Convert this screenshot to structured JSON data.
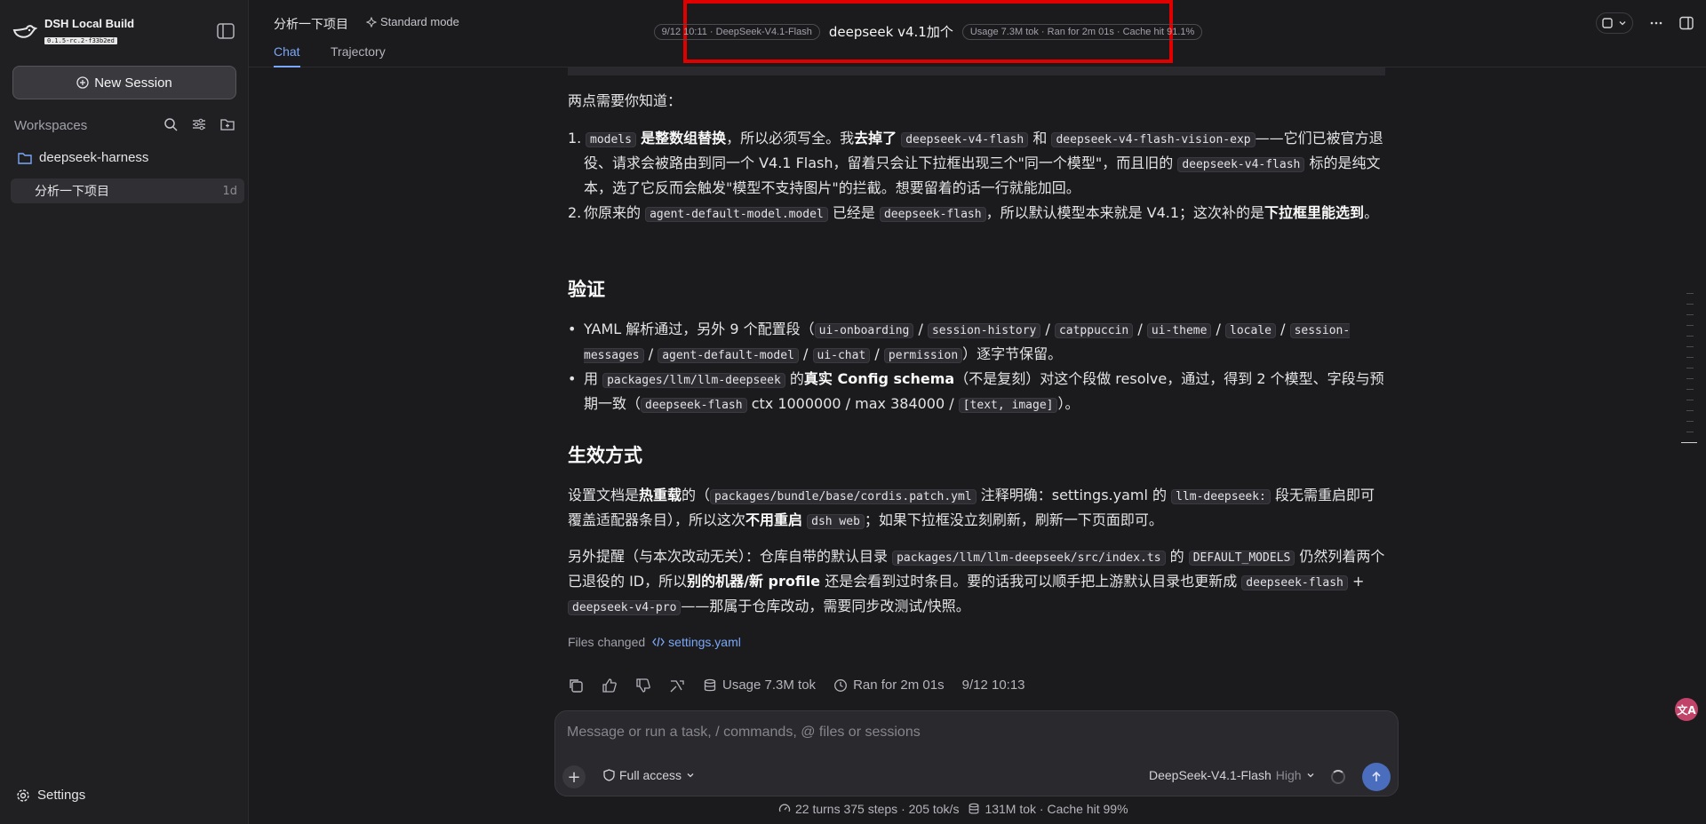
{
  "app": {
    "title": "DSH Local Build",
    "version": "0.1.5-rc.2-f33b2ed"
  },
  "sidebar": {
    "new_session": "New Session",
    "workspaces_label": "Workspaces",
    "project": "deepseek-harness",
    "session": {
      "label": "分析一下项目",
      "age": "1d"
    },
    "settings": "Settings"
  },
  "header": {
    "title": "分析一下项目",
    "mode": "Standard mode",
    "tabs": [
      "Chat",
      "Trajectory"
    ],
    "session_pill": "9/12 10:11 · DeepSeek-V4.1-Flash",
    "session_name": "deepseek v4.1加个",
    "usage_pill": "Usage 7.3M tok · Ran for 2m 01s · Cache hit 91.1%"
  },
  "content": {
    "intro": "两点需要你知道：",
    "ol": [
      {
        "marker": "1.",
        "code1": "models",
        "bold1": "是整数组替换",
        "t1": "，所以必须写全。我",
        "bold2": "去掉了",
        "code2": "deepseek-v4-flash",
        "t2": "和",
        "code3": "deepseek-v4-flash-vision-exp",
        "t3": "——它们已被官方退役、请求会被路由到同一个 V4.1 Flash，留着只会让下拉框出现三个\"同一个模型\"，而且旧的",
        "code4": "deepseek-v4-flash",
        "t4": "标的是纯文本，选了它反而会触发\"模型不支持图片\"的拦截。想要留着的话一行就能加回。"
      },
      {
        "marker": "2.",
        "t1": "你原来的",
        "code1": "agent-default-model.model",
        "t2": "已经是",
        "code2": "deepseek-flash",
        "t3": "，所以默认模型本来就是 V4.1；这次补的是",
        "bold1": "下拉框里能选到",
        "t4": "。"
      }
    ],
    "h_verify": "验证",
    "verify": [
      {
        "t1": "YAML 解析通过，另外 9 个配置段（",
        "codes": [
          "ui-onboarding",
          "session-history",
          "catppuccin",
          "ui-theme",
          "locale",
          "session-messages",
          "agent-default-model",
          "ui-chat",
          "permission"
        ],
        "sep": "/",
        "t2": "）逐字节保留。"
      },
      {
        "t1": "用",
        "code1": "packages/llm/llm-deepseek",
        "t2": "的",
        "bold1": "真实 Config schema",
        "t3": "（不是复刻）对这个段做 resolve，通过，得到 2 个模型、字段与预期一致（",
        "code2": "deepseek-flash",
        "t4": "ctx 1000000 / max 384000 /",
        "code3": "[text, image]",
        "t5": "）。"
      }
    ],
    "h_effect": "生效方式",
    "effect1": {
      "t1": "设置文档是",
      "bold1": "热重载",
      "t2": "的（",
      "code1": "packages/bundle/base/cordis.patch.yml",
      "t3": "注释明确：settings.yaml 的",
      "code2": "llm-deepseek:",
      "t4": "段无需重启即可覆盖适配器条目），所以这次",
      "bold2": "不用重启",
      "code3": "dsh web",
      "t5": "；如果下拉框没立刻刷新，刷新一下页面即可。"
    },
    "effect2": {
      "t1": "另外提醒（与本次改动无关）：仓库自带的默认目录",
      "code1": "packages/llm/llm-deepseek/src/index.ts",
      "t2": "的",
      "code2": "DEFAULT_MODELS",
      "t3": "仍然列着两个已退役的 ID，所以",
      "bold1": "别的机器/新 profile",
      "t4": "还是会看到过时条目。要的话我可以顺手把上游默认目录也更新成",
      "code3": "deepseek-flash",
      "t5": "+",
      "code4": "deepseek-v4-pro",
      "t6": "——那属于仓库改动，需要同步改测试/快照。"
    },
    "files_label": "Files changed",
    "files_link": "settings.yaml",
    "usage": "Usage 7.3M tok",
    "ran": "Ran for 2m 01s",
    "time": "9/12 10:13"
  },
  "composer": {
    "placeholder": "Message or run a task, / commands, @ files or sessions",
    "access": "Full access",
    "model": "DeepSeek-V4.1-Flash",
    "level": "High"
  },
  "status": {
    "turns": "22 turns 375 steps · 205 tok/s",
    "tokens": "131M tok · Cache hit 99%"
  },
  "colors": {
    "accent": "#7aa7f7",
    "highlight_border": "#e10000",
    "send_button": "#4a6dbd"
  }
}
